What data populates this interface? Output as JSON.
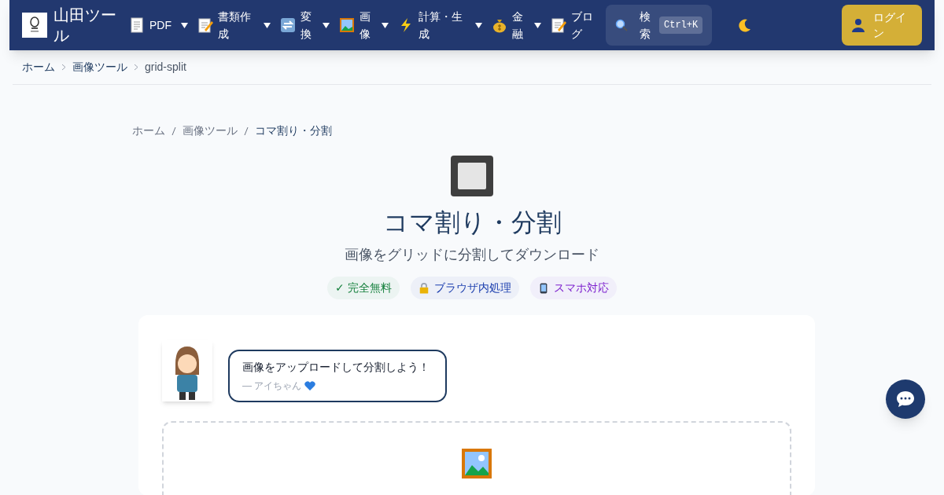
{
  "header": {
    "site_title": "山田ツール",
    "nav": [
      {
        "label": "PDF",
        "dropdown": true
      },
      {
        "label": "書類作成",
        "dropdown": true
      },
      {
        "label": "変換",
        "dropdown": true
      },
      {
        "label": "画像",
        "dropdown": true
      },
      {
        "label": "計算・生成",
        "dropdown": true
      },
      {
        "label": "金融",
        "dropdown": true
      },
      {
        "label": "ブログ",
        "dropdown": false
      }
    ],
    "search": {
      "label": "検索",
      "shortcut": "Ctrl+K"
    },
    "login": "ログイン"
  },
  "top_breadcrumb": [
    "ホーム",
    "画像ツール",
    "grid-split"
  ],
  "breadcrumb": [
    "ホーム",
    "画像ツール",
    "コマ割り・分割"
  ],
  "title": "コマ割り・分割",
  "subtitle": "画像をグリッドに分割してダウンロード",
  "badges": [
    {
      "kind": "check",
      "text": "✓ 完全無料",
      "color": "#15803d"
    },
    {
      "kind": "lock",
      "text": "ブラウザ内処理",
      "color": "#1e40af"
    },
    {
      "kind": "phone",
      "text": "スマホ対応",
      "color": "#7e22ce"
    }
  ],
  "speech": {
    "message": "画像をアップロードして分割しよう！",
    "signature": "— アイちゃん"
  }
}
